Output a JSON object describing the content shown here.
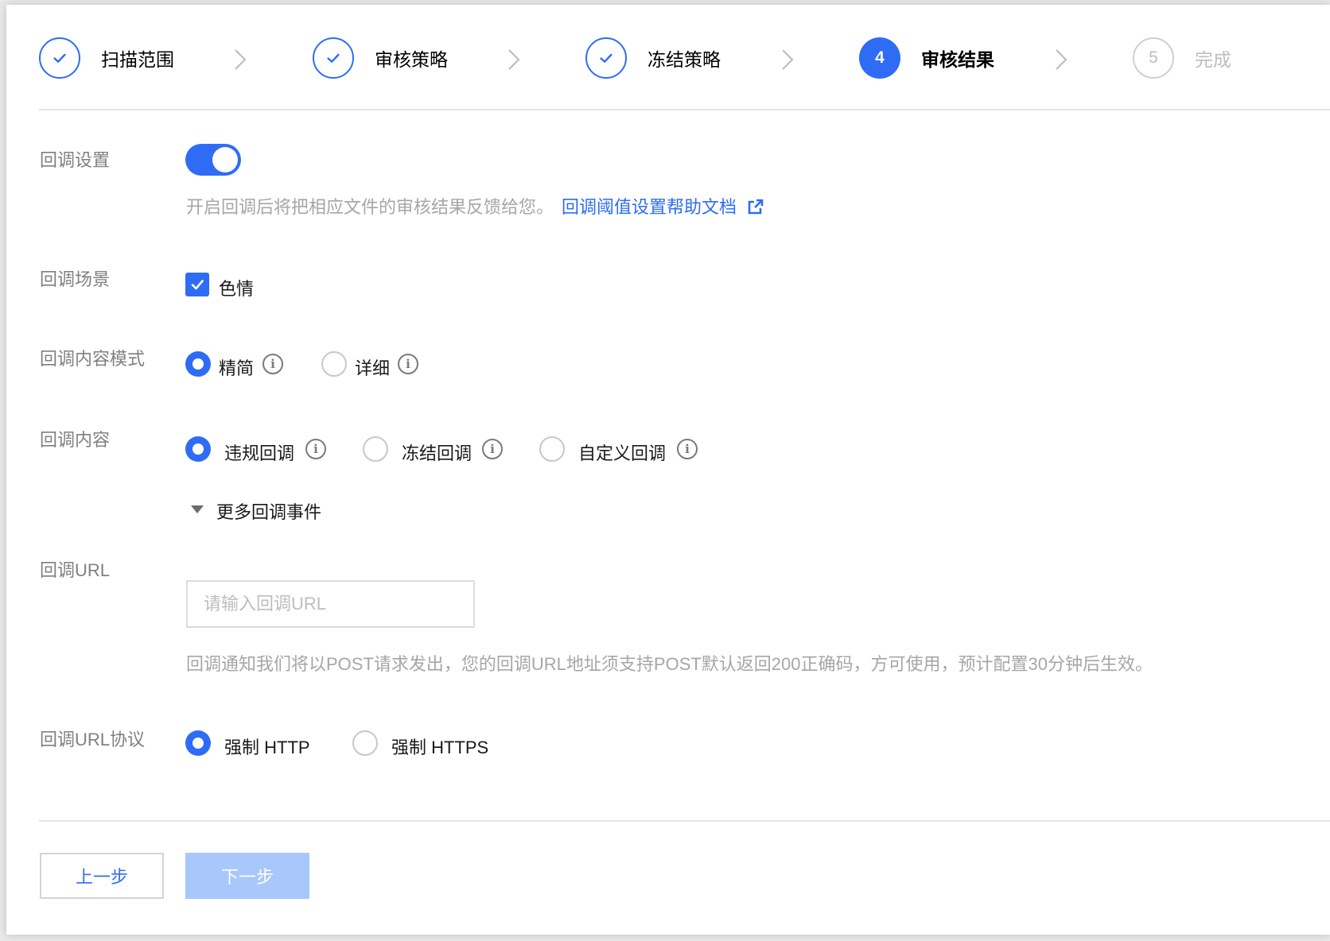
{
  "colors": {
    "primary": "#2f6cf6",
    "label_gray": "#808080",
    "hint_gray": "#a6a6a6",
    "disabled_button": "#a8c7fb"
  },
  "steps": [
    {
      "label": "扫描范围",
      "status": "done",
      "icon": "check-icon"
    },
    {
      "label": "审核策略",
      "status": "done",
      "icon": "check-icon"
    },
    {
      "label": "冻结策略",
      "status": "done",
      "icon": "check-icon"
    },
    {
      "label": "审核结果",
      "status": "current",
      "number": "4"
    },
    {
      "label": "完成",
      "status": "todo",
      "number": "5"
    }
  ],
  "callback_settings": {
    "label": "回调设置",
    "enabled": true,
    "hint": "开启回调后将把相应文件的审核结果反馈给您。",
    "help_link": "回调阈值设置帮助文档"
  },
  "callback_scene": {
    "label": "回调场景",
    "option": "色情",
    "checked": true
  },
  "callback_mode": {
    "label": "回调内容模式",
    "options": [
      "精简",
      "详细"
    ],
    "selected": "精简"
  },
  "callback_content": {
    "label": "回调内容",
    "options": [
      "违规回调",
      "冻结回调",
      "自定义回调"
    ],
    "selected": "违规回调",
    "more_events": "更多回调事件"
  },
  "callback_url": {
    "label": "回调URL",
    "placeholder": "请输入回调URL",
    "value": "",
    "hint": "回调通知我们将以POST请求发出，您的回调URL地址须支持POST默认返回200正确码，方可使用，预计配置30分钟后生效。"
  },
  "callback_protocol": {
    "label": "回调URL协议",
    "options": [
      "强制 HTTP",
      "强制 HTTPS"
    ],
    "selected": "强制 HTTP"
  },
  "buttons": {
    "prev": "上一步",
    "next": "下一步"
  }
}
